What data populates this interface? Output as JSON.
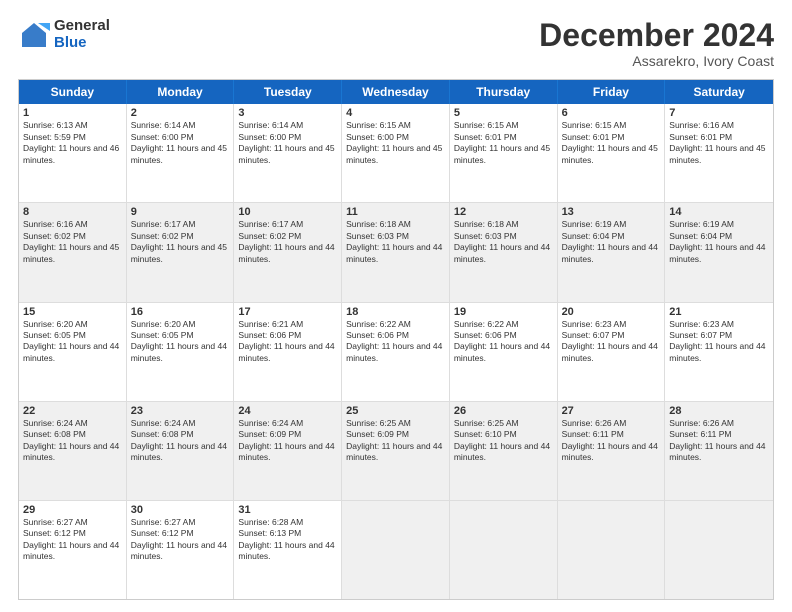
{
  "logo": {
    "general": "General",
    "blue": "Blue"
  },
  "title": "December 2024",
  "subtitle": "Assarekro, Ivory Coast",
  "days": [
    "Sunday",
    "Monday",
    "Tuesday",
    "Wednesday",
    "Thursday",
    "Friday",
    "Saturday"
  ],
  "weeks": [
    [
      {
        "day": "1",
        "sunrise": "Sunrise: 6:13 AM",
        "sunset": "Sunset: 5:59 PM",
        "daylight": "Daylight: 11 hours and 46 minutes."
      },
      {
        "day": "2",
        "sunrise": "Sunrise: 6:14 AM",
        "sunset": "Sunset: 6:00 PM",
        "daylight": "Daylight: 11 hours and 45 minutes."
      },
      {
        "day": "3",
        "sunrise": "Sunrise: 6:14 AM",
        "sunset": "Sunset: 6:00 PM",
        "daylight": "Daylight: 11 hours and 45 minutes."
      },
      {
        "day": "4",
        "sunrise": "Sunrise: 6:15 AM",
        "sunset": "Sunset: 6:00 PM",
        "daylight": "Daylight: 11 hours and 45 minutes."
      },
      {
        "day": "5",
        "sunrise": "Sunrise: 6:15 AM",
        "sunset": "Sunset: 6:01 PM",
        "daylight": "Daylight: 11 hours and 45 minutes."
      },
      {
        "day": "6",
        "sunrise": "Sunrise: 6:15 AM",
        "sunset": "Sunset: 6:01 PM",
        "daylight": "Daylight: 11 hours and 45 minutes."
      },
      {
        "day": "7",
        "sunrise": "Sunrise: 6:16 AM",
        "sunset": "Sunset: 6:01 PM",
        "daylight": "Daylight: 11 hours and 45 minutes."
      }
    ],
    [
      {
        "day": "8",
        "sunrise": "Sunrise: 6:16 AM",
        "sunset": "Sunset: 6:02 PM",
        "daylight": "Daylight: 11 hours and 45 minutes."
      },
      {
        "day": "9",
        "sunrise": "Sunrise: 6:17 AM",
        "sunset": "Sunset: 6:02 PM",
        "daylight": "Daylight: 11 hours and 45 minutes."
      },
      {
        "day": "10",
        "sunrise": "Sunrise: 6:17 AM",
        "sunset": "Sunset: 6:02 PM",
        "daylight": "Daylight: 11 hours and 44 minutes."
      },
      {
        "day": "11",
        "sunrise": "Sunrise: 6:18 AM",
        "sunset": "Sunset: 6:03 PM",
        "daylight": "Daylight: 11 hours and 44 minutes."
      },
      {
        "day": "12",
        "sunrise": "Sunrise: 6:18 AM",
        "sunset": "Sunset: 6:03 PM",
        "daylight": "Daylight: 11 hours and 44 minutes."
      },
      {
        "day": "13",
        "sunrise": "Sunrise: 6:19 AM",
        "sunset": "Sunset: 6:04 PM",
        "daylight": "Daylight: 11 hours and 44 minutes."
      },
      {
        "day": "14",
        "sunrise": "Sunrise: 6:19 AM",
        "sunset": "Sunset: 6:04 PM",
        "daylight": "Daylight: 11 hours and 44 minutes."
      }
    ],
    [
      {
        "day": "15",
        "sunrise": "Sunrise: 6:20 AM",
        "sunset": "Sunset: 6:05 PM",
        "daylight": "Daylight: 11 hours and 44 minutes."
      },
      {
        "day": "16",
        "sunrise": "Sunrise: 6:20 AM",
        "sunset": "Sunset: 6:05 PM",
        "daylight": "Daylight: 11 hours and 44 minutes."
      },
      {
        "day": "17",
        "sunrise": "Sunrise: 6:21 AM",
        "sunset": "Sunset: 6:06 PM",
        "daylight": "Daylight: 11 hours and 44 minutes."
      },
      {
        "day": "18",
        "sunrise": "Sunrise: 6:22 AM",
        "sunset": "Sunset: 6:06 PM",
        "daylight": "Daylight: 11 hours and 44 minutes."
      },
      {
        "day": "19",
        "sunrise": "Sunrise: 6:22 AM",
        "sunset": "Sunset: 6:06 PM",
        "daylight": "Daylight: 11 hours and 44 minutes."
      },
      {
        "day": "20",
        "sunrise": "Sunrise: 6:23 AM",
        "sunset": "Sunset: 6:07 PM",
        "daylight": "Daylight: 11 hours and 44 minutes."
      },
      {
        "day": "21",
        "sunrise": "Sunrise: 6:23 AM",
        "sunset": "Sunset: 6:07 PM",
        "daylight": "Daylight: 11 hours and 44 minutes."
      }
    ],
    [
      {
        "day": "22",
        "sunrise": "Sunrise: 6:24 AM",
        "sunset": "Sunset: 6:08 PM",
        "daylight": "Daylight: 11 hours and 44 minutes."
      },
      {
        "day": "23",
        "sunrise": "Sunrise: 6:24 AM",
        "sunset": "Sunset: 6:08 PM",
        "daylight": "Daylight: 11 hours and 44 minutes."
      },
      {
        "day": "24",
        "sunrise": "Sunrise: 6:24 AM",
        "sunset": "Sunset: 6:09 PM",
        "daylight": "Daylight: 11 hours and 44 minutes."
      },
      {
        "day": "25",
        "sunrise": "Sunrise: 6:25 AM",
        "sunset": "Sunset: 6:09 PM",
        "daylight": "Daylight: 11 hours and 44 minutes."
      },
      {
        "day": "26",
        "sunrise": "Sunrise: 6:25 AM",
        "sunset": "Sunset: 6:10 PM",
        "daylight": "Daylight: 11 hours and 44 minutes."
      },
      {
        "day": "27",
        "sunrise": "Sunrise: 6:26 AM",
        "sunset": "Sunset: 6:11 PM",
        "daylight": "Daylight: 11 hours and 44 minutes."
      },
      {
        "day": "28",
        "sunrise": "Sunrise: 6:26 AM",
        "sunset": "Sunset: 6:11 PM",
        "daylight": "Daylight: 11 hours and 44 minutes."
      }
    ],
    [
      {
        "day": "29",
        "sunrise": "Sunrise: 6:27 AM",
        "sunset": "Sunset: 6:12 PM",
        "daylight": "Daylight: 11 hours and 44 minutes."
      },
      {
        "day": "30",
        "sunrise": "Sunrise: 6:27 AM",
        "sunset": "Sunset: 6:12 PM",
        "daylight": "Daylight: 11 hours and 44 minutes."
      },
      {
        "day": "31",
        "sunrise": "Sunrise: 6:28 AM",
        "sunset": "Sunset: 6:13 PM",
        "daylight": "Daylight: 11 hours and 44 minutes."
      },
      null,
      null,
      null,
      null
    ]
  ]
}
